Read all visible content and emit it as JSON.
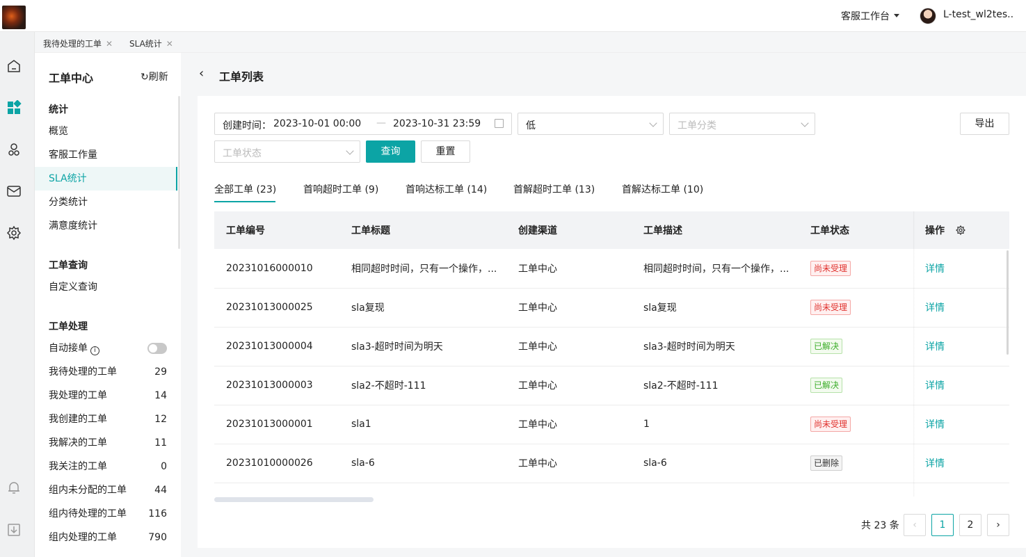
{
  "topbar": {
    "workbench_label": "客服工作台",
    "username": "L-test_wl2tes..."
  },
  "page_tabs": [
    {
      "label": "我待处理的工单"
    },
    {
      "label": "SLA统计"
    }
  ],
  "sidebar": {
    "title": "工单中心",
    "refresh_label": "刷新",
    "groups": {
      "stats": {
        "title": "统计",
        "items": [
          "概览",
          "客服工作量",
          "SLA统计",
          "分类统计",
          "满意度统计"
        ]
      },
      "query": {
        "title": "工单查询",
        "items": [
          "自定义查询"
        ]
      },
      "processing": {
        "title": "工单处理",
        "auto_accept_label": "自动接单",
        "items": [
          {
            "label": "我待处理的工单",
            "count": "29"
          },
          {
            "label": "我处理的工单",
            "count": "14"
          },
          {
            "label": "我创建的工单",
            "count": "12"
          },
          {
            "label": "我解决的工单",
            "count": "11"
          },
          {
            "label": "我关注的工单",
            "count": "0"
          },
          {
            "label": "组内未分配的工单",
            "count": "44"
          },
          {
            "label": "组内待处理的工单",
            "count": "116"
          },
          {
            "label": "组内处理的工单",
            "count": "790"
          }
        ]
      }
    }
  },
  "main": {
    "title": "工单列表",
    "filters": {
      "date_label": "创建时间：",
      "date_start": "2023-10-01 00:00",
      "date_end": "2023-10-31 23:59",
      "priority_value": "低",
      "category_placeholder": "工单分类",
      "status_placeholder": "工单状态",
      "query_button": "查询",
      "reset_button": "重置",
      "export_button": "导出"
    },
    "tabs": [
      {
        "label": "全部工单 (23)"
      },
      {
        "label": "首响超时工单 (9)"
      },
      {
        "label": "首响达标工单 (14)"
      },
      {
        "label": "首解超时工单 (13)"
      },
      {
        "label": "首解达标工单 (10)"
      }
    ],
    "table": {
      "headers": [
        "工单编号",
        "工单标题",
        "创建渠道",
        "工单描述",
        "工单状态",
        "操作"
      ],
      "rows": [
        {
          "id": "20231016000010",
          "title": "相同超时时间，只有一个操作，...",
          "channel": "工单中心",
          "desc": "相同超时时间，只有一个操作，...",
          "status": "尚未受理",
          "action": "详情"
        },
        {
          "id": "20231013000025",
          "title": "sla复现",
          "channel": "工单中心",
          "desc": "sla复现",
          "status": "尚未受理",
          "action": "详情"
        },
        {
          "id": "20231013000004",
          "title": "sla3-超时时间为明天",
          "channel": "工单中心",
          "desc": "sla3-超时时间为明天",
          "status": "已解决",
          "action": "详情"
        },
        {
          "id": "20231013000003",
          "title": "sla2-不超时-111",
          "channel": "工单中心",
          "desc": "sla2-不超时-111",
          "status": "已解决",
          "action": "详情"
        },
        {
          "id": "20231013000001",
          "title": "sla1",
          "channel": "工单中心",
          "desc": "1",
          "status": "尚未受理",
          "action": "详情"
        },
        {
          "id": "20231010000026",
          "title": "sla-6",
          "channel": "工单中心",
          "desc": "sla-6",
          "status": "已删除",
          "action": "详情"
        }
      ]
    },
    "pagination": {
      "total_label": "共 23 条",
      "prev": "‹",
      "pages": [
        "1",
        "2"
      ],
      "next": "›"
    }
  },
  "colors": {
    "accent": "#0ca4a5",
    "status_red": "#e0322e",
    "status_green": "#3dae2b"
  },
  "icons": [
    "home-icon",
    "dashboard-icon",
    "user-group-icon",
    "mail-icon",
    "gear-icon",
    "bell-icon",
    "download-icon",
    "calendar-icon",
    "refresh-icon",
    "info-icon",
    "back-icon"
  ]
}
